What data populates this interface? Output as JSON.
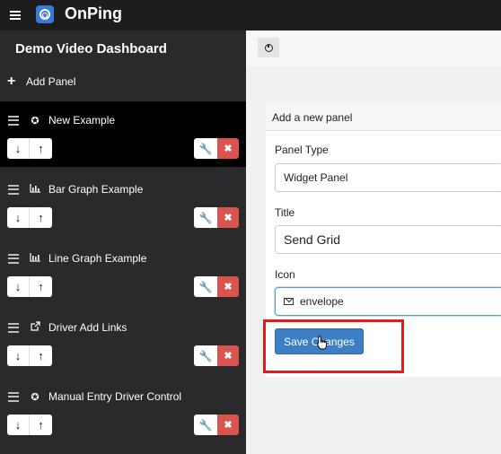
{
  "app": {
    "title": "OnPing"
  },
  "sidebar": {
    "dashboard_title": "Demo Video Dashboard",
    "add_panel_label": "Add Panel",
    "items": [
      {
        "label": "New Example",
        "icon": "widget-icon",
        "active": true
      },
      {
        "label": "Bar Graph Example",
        "icon": "bar-chart-icon",
        "active": false
      },
      {
        "label": "Line Graph Example",
        "icon": "line-chart-icon",
        "active": false
      },
      {
        "label": "Driver Add Links",
        "icon": "external-link-icon",
        "active": false
      },
      {
        "label": "Manual Entry Driver Control",
        "icon": "widget-icon",
        "active": false
      }
    ]
  },
  "form": {
    "header": "Add a new panel",
    "panel_type_label": "Panel Type",
    "panel_type_value": "Widget Panel",
    "title_label": "Title",
    "title_value": "Send Grid",
    "icon_label": "Icon",
    "icon_value": "envelope",
    "save_label": "Save Changes"
  },
  "colors": {
    "accent": "#3d7ec5",
    "danger": "#d9534f",
    "highlight": "#e31b1b",
    "sidebar_bg": "#2a2a2d",
    "topbar_bg": "#1d1d1f"
  }
}
